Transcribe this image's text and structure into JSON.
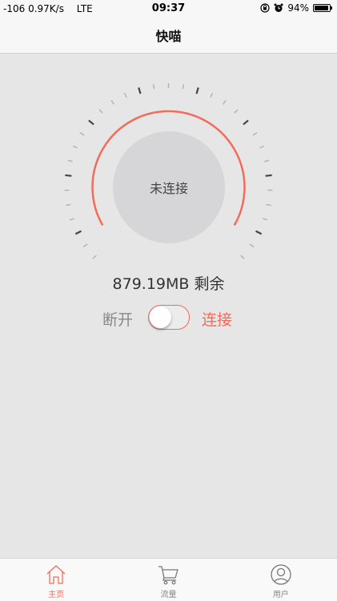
{
  "status_bar": {
    "signal": "-106",
    "speed": "0.97K/s",
    "carrier": "LTE",
    "time": "09:37",
    "battery": "94%",
    "battery_level": 0.94
  },
  "header": {
    "title": "快喵"
  },
  "gauge": {
    "status": "未连接"
  },
  "data": {
    "remaining": "879.19MB 剩余"
  },
  "toggle": {
    "off_label": "断开",
    "on_label": "连接",
    "state": "off"
  },
  "tabs": [
    {
      "label": "主页",
      "icon": "home-icon",
      "active": true
    },
    {
      "label": "流量",
      "icon": "cart-icon",
      "active": false
    },
    {
      "label": "用户",
      "icon": "user-icon",
      "active": false
    }
  ],
  "colors": {
    "accent": "#f26b5b",
    "background": "#e6e6e6",
    "tick": "#555555"
  }
}
